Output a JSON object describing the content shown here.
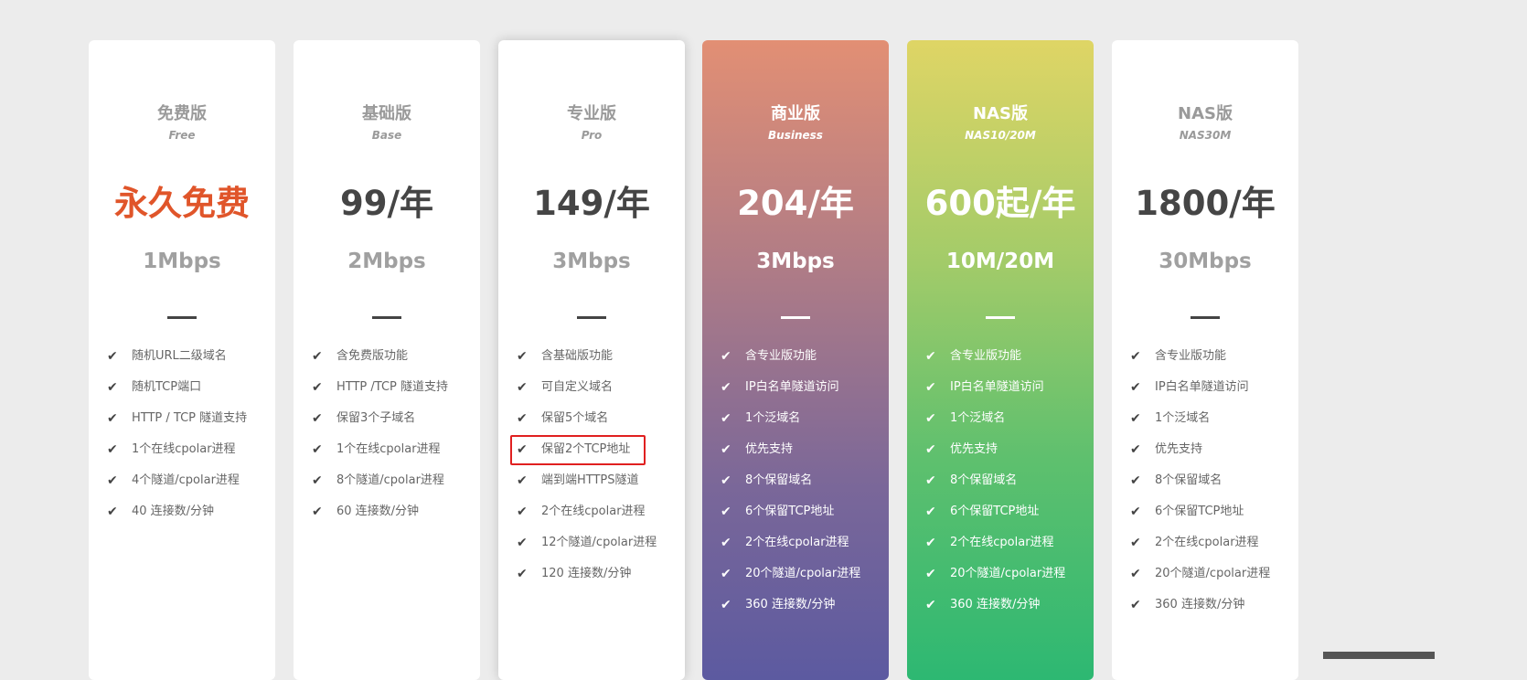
{
  "plans": [
    {
      "title": "免费版",
      "subtitle": "Free",
      "price": "永久免费",
      "speed": "1Mbps",
      "features": [
        "随机URL二级域名",
        "随机TCP端口",
        "HTTP / TCP 隧道支持",
        "1个在线cpolar进程",
        "4个隧道/cpolar进程",
        "40 连接数/分钟"
      ]
    },
    {
      "title": "基础版",
      "subtitle": "Base",
      "price": "99/年",
      "speed": "2Mbps",
      "features": [
        "含免费版功能",
        "HTTP /TCP 隧道支持",
        "保留3个子域名",
        "1个在线cpolar进程",
        "8个隧道/cpolar进程",
        "60 连接数/分钟"
      ]
    },
    {
      "title": "专业版",
      "subtitle": "Pro",
      "price": "149/年",
      "speed": "3Mbps",
      "features": [
        "含基础版功能",
        "可自定义域名",
        "保留5个域名",
        "保留2个TCP地址",
        "端到端HTTPS隧道",
        "2个在线cpolar进程",
        "12个隧道/cpolar进程",
        "120 连接数/分钟"
      ]
    },
    {
      "title": "商业版",
      "subtitle": "Business",
      "price": "204/年",
      "speed": "3Mbps",
      "features": [
        "含专业版功能",
        "IP白名单隧道访问",
        "1个泛域名",
        "优先支持",
        "8个保留域名",
        "6个保留TCP地址",
        "2个在线cpolar进程",
        "20个隧道/cpolar进程",
        "360 连接数/分钟"
      ]
    },
    {
      "title": "NAS版",
      "subtitle": "NAS10/20M",
      "price": "600起/年",
      "speed": "10M/20M",
      "features": [
        "含专业版功能",
        "IP白名单隧道访问",
        "1个泛域名",
        "优先支持",
        "8个保留域名",
        "6个保留TCP地址",
        "2个在线cpolar进程",
        "20个隧道/cpolar进程",
        "360 连接数/分钟"
      ]
    },
    {
      "title": "NAS版",
      "subtitle": "NAS30M",
      "price": "1800/年",
      "speed": "30Mbps",
      "features": [
        "含专业版功能",
        "IP白名单隧道访问",
        "1个泛域名",
        "优先支持",
        "8个保留域名",
        "6个保留TCP地址",
        "2个在线cpolar进程",
        "20个隧道/cpolar进程",
        "360 连接数/分钟"
      ]
    }
  ],
  "colors": {
    "free_price": "#e0552a",
    "highlight": "#e02020"
  }
}
